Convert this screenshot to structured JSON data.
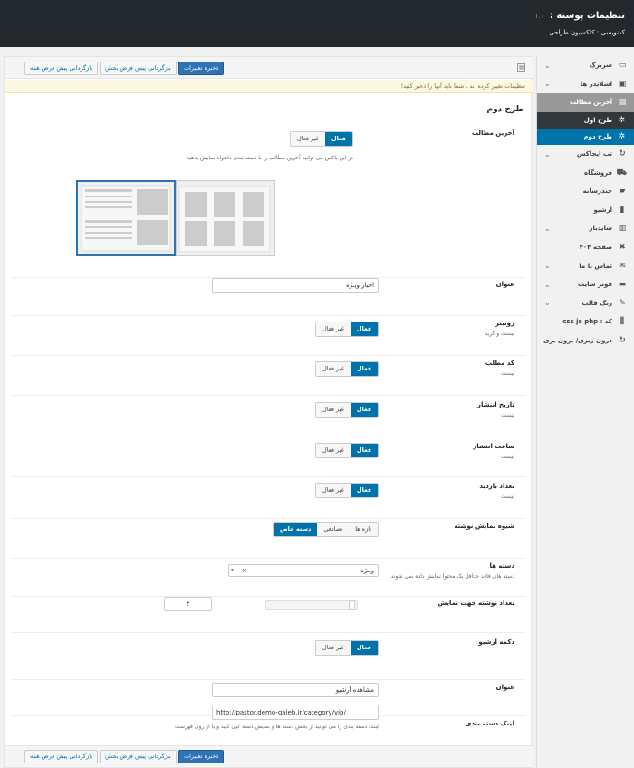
{
  "header": {
    "title": "تنظیمات پوسته :",
    "version": "۱.۰",
    "subtitle": "کدنویسی : کلکسیون طراحی"
  },
  "toolbar": {
    "save_label": "ذخیره تغییرات",
    "reset_section_label": "بازگردانی پیش فرض بخش",
    "reset_all_label": "بازگردانی پیش فرض همه"
  },
  "notice": "تنظیمات تغییر کرده اند ، شما باید آنها را ذخیر کنید!",
  "section_title": "طرح دوم",
  "sidebar": {
    "items": [
      {
        "label": "سربرگ",
        "icon": "monitor-icon"
      },
      {
        "label": "اسلایدر ها",
        "icon": "slider-icon"
      },
      {
        "label": "آخرین مطالب",
        "icon": "posts-icon"
      },
      {
        "label": "طرح اول",
        "icon": "gear-icon"
      },
      {
        "label": "طرح دوم",
        "icon": "gear-icon"
      },
      {
        "label": "تب ایجاکس",
        "icon": "refresh-icon"
      },
      {
        "label": "فروشگاه",
        "icon": "cart-icon"
      },
      {
        "label": "چندرسانه",
        "icon": "folder-icon"
      },
      {
        "label": "آرشیو",
        "icon": "archive-icon"
      },
      {
        "label": "سایدبار",
        "icon": "columns-icon"
      },
      {
        "label": "صفحه ۴۰۴",
        "icon": "close-icon"
      },
      {
        "label": "تماس با ما",
        "icon": "mail-icon"
      },
      {
        "label": "فوتر سایت",
        "icon": "footer-icon"
      },
      {
        "label": "رنگ قالب",
        "icon": "brush-icon"
      },
      {
        "label": "کد : css js php",
        "icon": "sliders-icon"
      },
      {
        "label": "درون ریزی/ برون بری",
        "icon": "refresh-icon"
      }
    ]
  },
  "fields": {
    "latest": {
      "label": "آخرین مطالب",
      "on": "فعال",
      "off": "غیر فعال",
      "desc": "در این باکس می توانید آخرین مطالب را با دسته بندی دلخواه نمایش بدهید"
    },
    "title1": {
      "label": "عنوان",
      "value": "اخبار ویـژه"
    },
    "rotator": {
      "label": "روتیتر",
      "desc": "لیست و گرید",
      "on": "فعال",
      "off": "غیر فعال"
    },
    "code": {
      "label": "کد مطلب",
      "desc": "لیست",
      "on": "فعال",
      "off": "غیر فعال"
    },
    "pubdate": {
      "label": "تاریخ انتشار",
      "desc": "لیست",
      "on": "فعال",
      "off": "غیر فعال"
    },
    "pubtime": {
      "label": "ساعت انتشار",
      "desc": "لیست",
      "on": "فعال",
      "off": "غیر فعال"
    },
    "views": {
      "label": "تعداد بازدید",
      "desc": "لیست",
      "on": "فعال",
      "off": "غیر فعال"
    },
    "display": {
      "label": "شیوه نمایش نوشته",
      "options": [
        "تازه ها",
        "تصادفی",
        "دسته خاص"
      ],
      "selected": "دسته خاص"
    },
    "categories": {
      "label": "دسته ها",
      "desc": "دسته های فاقد حداقل یک محتوا نمایش داده نمی شوند",
      "value": "ویـژه",
      "clear": "×"
    },
    "count": {
      "label": "تعداد نوشته جهت نمایش",
      "value": "۳",
      "slider_fraction": 0.85
    },
    "archive": {
      "label": "دکمه آرشیو",
      "on": "فعال",
      "off": "غیر فعال"
    },
    "title2": {
      "label": "عنوان",
      "value": "مشاهده آرشیو"
    },
    "catlink": {
      "label": "لینک دسته بندی",
      "value": "http://pastor.demo-qaleb.ir/category/vip/",
      "desc": "لینک دسته بندی را می توانید از بخش دسته ها و نمایش دسته کپی کنید و یا از روی فهرست"
    }
  }
}
